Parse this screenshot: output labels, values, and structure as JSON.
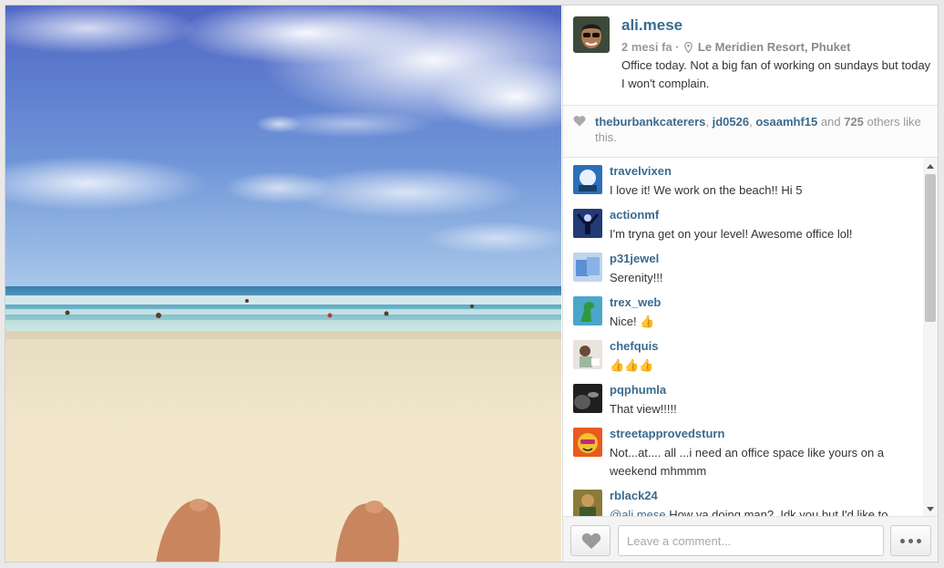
{
  "post": {
    "username": "ali.mese",
    "time_ago": "2 mesi fa",
    "separator": "·",
    "location": "Le Meridien Resort, Phuket",
    "caption": "Office today. Not a big fan of working on sundays but today I won't complain."
  },
  "likes": {
    "users": [
      "theburbankcaterers",
      "jd0526",
      "osaamhf15"
    ],
    "sep1": ", ",
    "sep2": ", ",
    "and_word": " and ",
    "count": "725",
    "suffix": " others like this."
  },
  "comments": [
    {
      "user": "travelvixen",
      "text": "I love it! We work on the beach!! Hi 5"
    },
    {
      "user": "actionmf",
      "text": "I'm tryna get on your level! Awesome office lol!"
    },
    {
      "user": "p31jewel",
      "text": "Serenity!!!"
    },
    {
      "user": "trex_web",
      "text": "Nice! 👍"
    },
    {
      "user": "chefquis",
      "text": "👍👍👍"
    },
    {
      "user": "pqphumla",
      "text": "That view!!!!!"
    },
    {
      "user": "streetapprovedsturn",
      "text": "Not...at.... all ...i need an office space like yours on a weekend mhmmm"
    },
    {
      "user": "rblack24",
      "mention": "@ali.mese",
      "text": " How ya doing man?. Idk you but I'd like to"
    }
  ],
  "footer": {
    "comment_placeholder": "Leave a comment..."
  },
  "icons": {
    "like": "heart-icon",
    "location": "pin-icon",
    "more": "ellipsis-icon"
  },
  "colors": {
    "username": "#3b6b8f",
    "muted": "#999999"
  }
}
